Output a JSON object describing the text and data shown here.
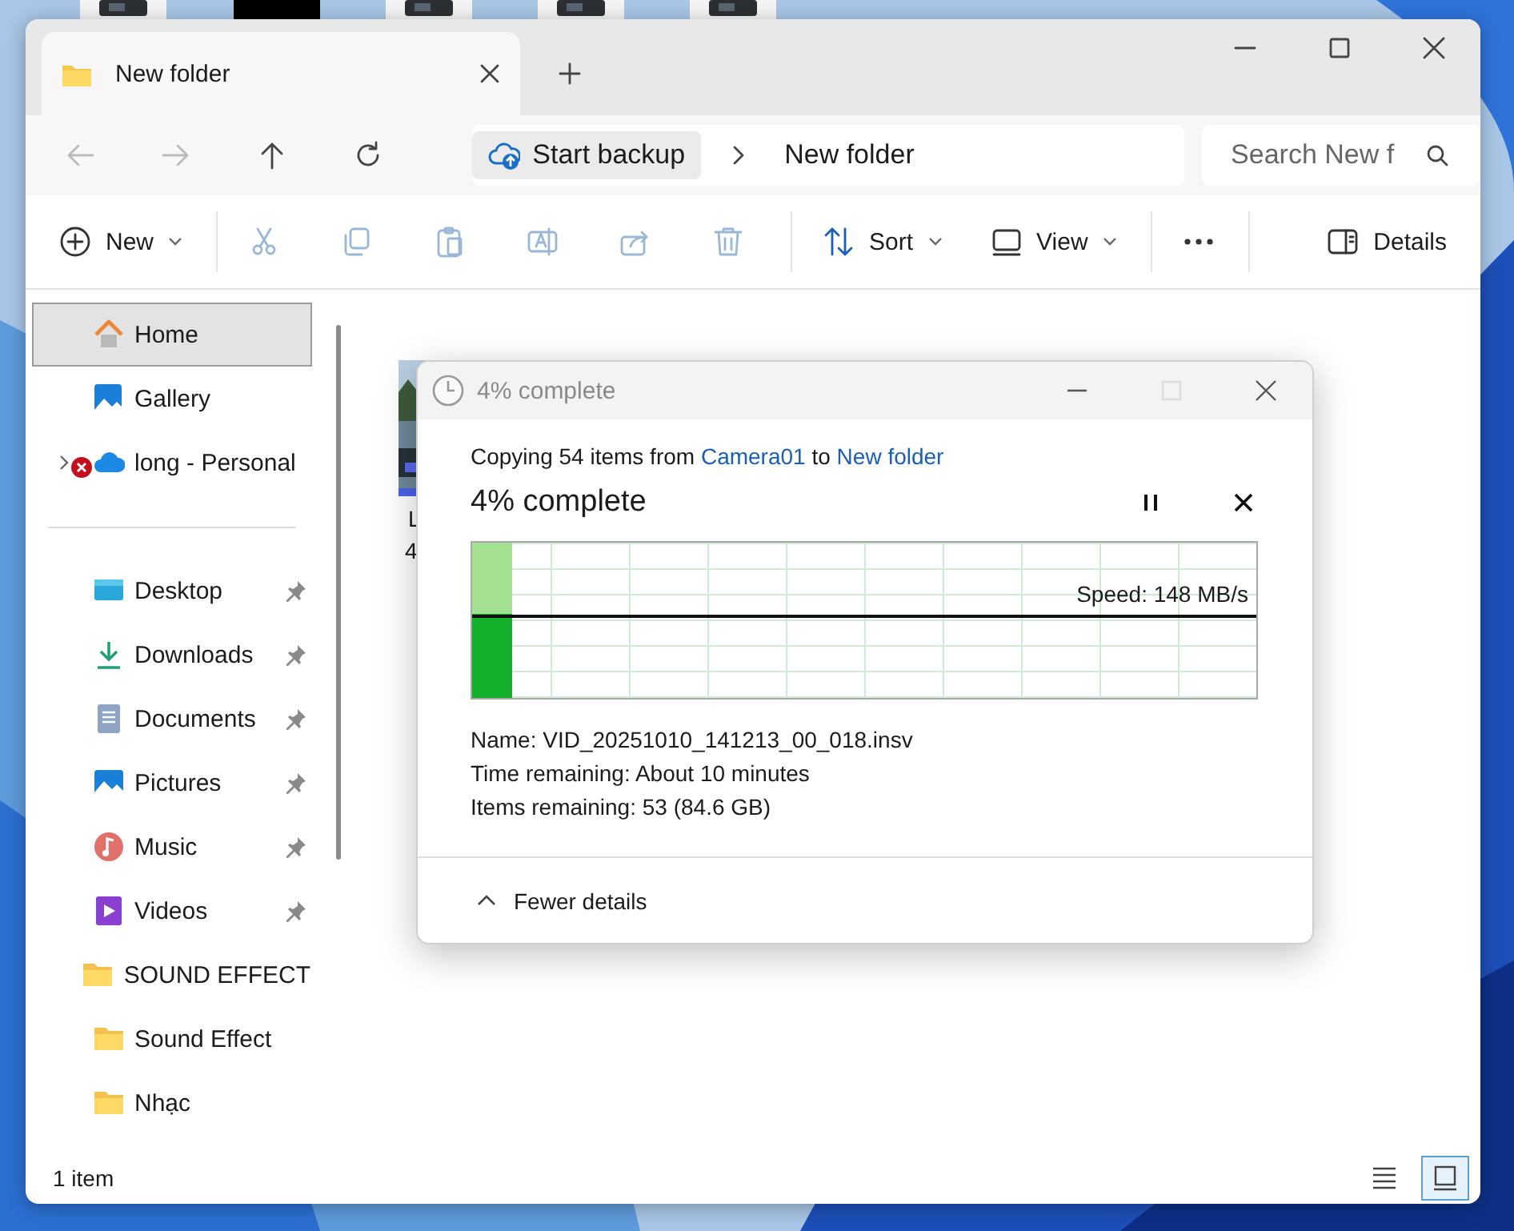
{
  "window": {
    "tab": {
      "title": "New folder",
      "selected": true
    }
  },
  "address_bar": {
    "backup_button": "Start backup",
    "breadcrumb": [
      "New folder"
    ]
  },
  "search": {
    "placeholder": "Search New f"
  },
  "toolbar": [
    {
      "kind": "new",
      "label": "New",
      "dropdown": true,
      "disabled": false
    },
    {
      "kind": "cut",
      "disabled": true
    },
    {
      "kind": "copy",
      "disabled": true
    },
    {
      "kind": "paste",
      "disabled": true
    },
    {
      "kind": "rename",
      "disabled": true
    },
    {
      "kind": "share",
      "disabled": true
    },
    {
      "kind": "delete",
      "disabled": true
    },
    {
      "kind": "sort",
      "label": "Sort",
      "dropdown": true,
      "disabled": false
    },
    {
      "kind": "view",
      "label": "View",
      "dropdown": true,
      "disabled": false
    },
    {
      "kind": "more",
      "disabled": false
    },
    {
      "kind": "details",
      "label": "Details",
      "disabled": false
    }
  ],
  "sidebar": {
    "items": [
      {
        "kind": "home",
        "label": "Home",
        "selected": true,
        "pinned": false
      },
      {
        "kind": "gallery",
        "label": "Gallery",
        "selected": false,
        "pinned": false
      },
      {
        "kind": "cloud",
        "label": "long - Personal",
        "selected": false,
        "pinned": false,
        "expandable": true,
        "error": true
      },
      {
        "kind": "separator"
      },
      {
        "kind": "desktop",
        "label": "Desktop",
        "selected": false,
        "pinned": true
      },
      {
        "kind": "downloads",
        "label": "Downloads",
        "selected": false,
        "pinned": true
      },
      {
        "kind": "documents",
        "label": "Documents",
        "selected": false,
        "pinned": true
      },
      {
        "kind": "pictures",
        "label": "Pictures",
        "selected": false,
        "pinned": true
      },
      {
        "kind": "music",
        "label": "Music",
        "selected": false,
        "pinned": true
      },
      {
        "kind": "videos",
        "label": "Videos",
        "selected": false,
        "pinned": true
      },
      {
        "kind": "folder",
        "label": "SOUND EFFECT",
        "selected": false,
        "pinned": false
      },
      {
        "kind": "folder",
        "label": "Sound Effect",
        "selected": false,
        "pinned": false
      },
      {
        "kind": "folder",
        "label": "Nhạc",
        "selected": false,
        "pinned": false
      }
    ]
  },
  "files": [
    {
      "kind": "picture",
      "name": "L",
      "detail": "4"
    }
  ],
  "status_bar": {
    "count": "1 item",
    "views": [
      {
        "kind": "list",
        "selected": false
      },
      {
        "kind": "tiles",
        "selected": true
      }
    ]
  },
  "copy_dialog": {
    "title": "4% complete",
    "summary": {
      "prefix": "Copying 54 items from",
      "source": "Camera01",
      "joiner": "to",
      "destination": "New folder"
    },
    "heading": "4% complete",
    "progress": {
      "level": 0.05
    },
    "speed": "Speed: 148 MB/s",
    "details": [
      "Name:  VID_20251010_141213_00_018.insv",
      "Time remaining:  About 10 minutes",
      "Items remaining:  53 (84.6 GB)"
    ],
    "toggle": "Fewer details"
  }
}
